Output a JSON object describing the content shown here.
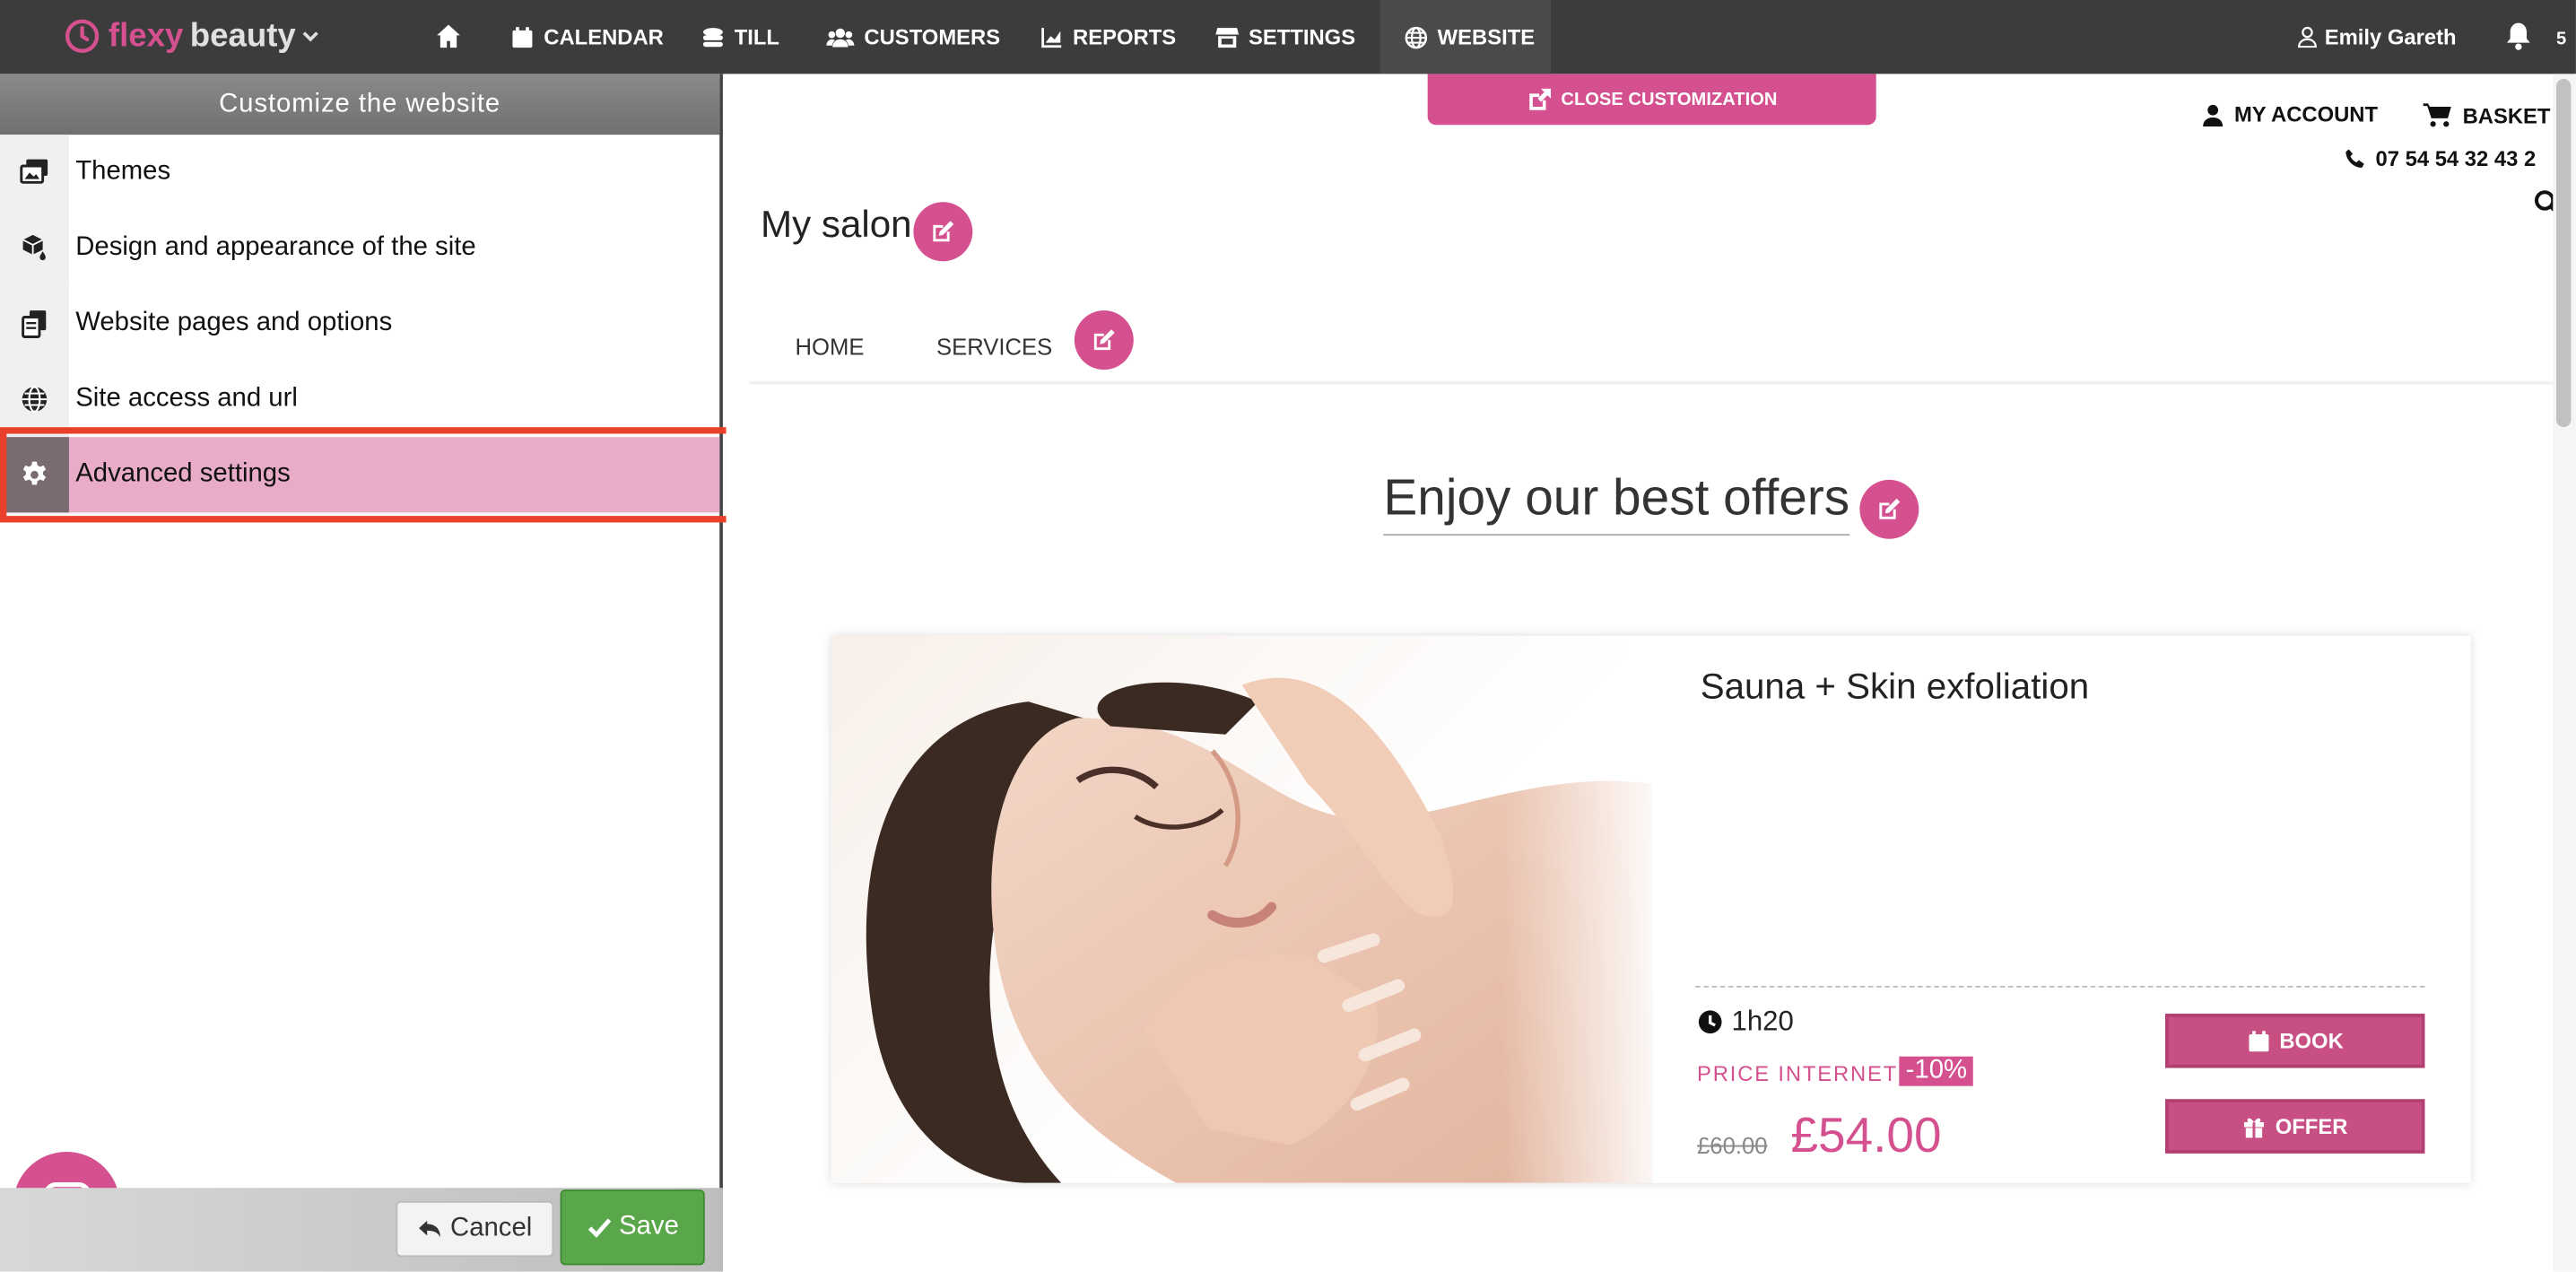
{
  "brand": {
    "part1": "flexy",
    "part2": "beauty",
    "chevron": "chevron-down-icon"
  },
  "nav": [
    {
      "label": "CALENDAR",
      "icon": "calendar-icon"
    },
    {
      "label": "TILL",
      "icon": "coins-icon"
    },
    {
      "label": "CUSTOMERS",
      "icon": "users-icon"
    },
    {
      "label": "REPORTS",
      "icon": "chart-icon"
    },
    {
      "label": "SETTINGS",
      "icon": "store-icon"
    },
    {
      "label": "WEBSITE",
      "icon": "globe-icon"
    }
  ],
  "user": {
    "name": "Emily Gareth",
    "notification_count": "5"
  },
  "sidebar": {
    "title": "Customize the website",
    "items": [
      {
        "label": "Themes",
        "icon": "themes-icon"
      },
      {
        "label": "Design and appearance of the site",
        "icon": "paint-icon"
      },
      {
        "label": "Website pages and options",
        "icon": "pages-icon"
      },
      {
        "label": "Site access and url",
        "icon": "globe-icon"
      },
      {
        "label": "Advanced settings",
        "icon": "gear-icon",
        "active": true
      }
    ],
    "cancel_label": "Cancel",
    "save_label": "Save"
  },
  "preview": {
    "close_label": "CLOSE CUSTOMIZATION",
    "my_account": "MY ACCOUNT",
    "basket": "BASKET",
    "phone": "07 54 54 32 43 2",
    "site_title": "My salon",
    "menu": [
      "HOME",
      "SERVICES"
    ],
    "offers_heading": "Enjoy our best offers",
    "offer": {
      "title": "Sauna + Skin exfoliation",
      "duration": "1h20",
      "price_label": "PRICE INTERNET",
      "discount": "-10%",
      "old_price": "£60.00",
      "new_price": "£54.00",
      "book_label": "BOOK",
      "offer_label": "OFFER"
    }
  },
  "colors": {
    "accent": "#d4508f",
    "topbar": "#3c3c3c",
    "save": "#5aa64a",
    "highlight": "#e8402a"
  }
}
